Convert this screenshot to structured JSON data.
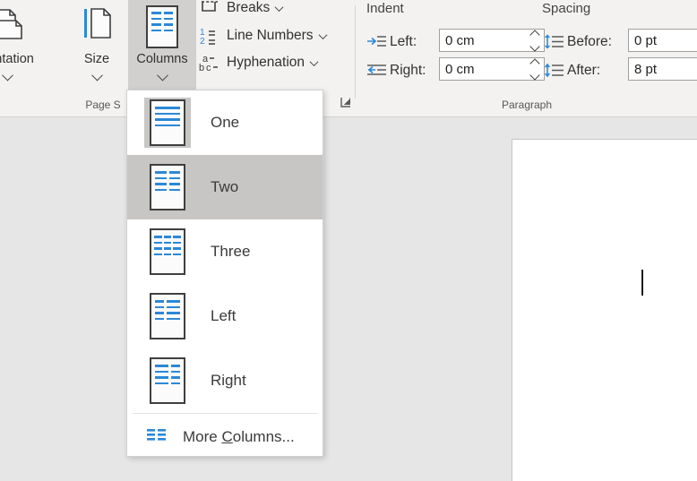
{
  "ribbon": {
    "groups": [
      {
        "label": "Page S",
        "full_label": "Page Setup"
      },
      {
        "label": "Paragraph",
        "full_label": "Paragraph"
      }
    ],
    "page_setup": {
      "buttons": [
        {
          "label": "rientation",
          "full_label": "Orientation",
          "icon": "orientation-icon",
          "has_dropdown": true
        },
        {
          "label": "Size",
          "icon": "page-size-icon",
          "has_dropdown": true
        },
        {
          "label": "Columns",
          "icon": "columns-icon",
          "has_dropdown": true,
          "active": true
        }
      ],
      "small_buttons": [
        {
          "label": "Breaks",
          "icon": "breaks-icon",
          "has_dropdown": true
        },
        {
          "label": "Line Numbers",
          "icon": "line-numbers-icon",
          "has_dropdown": true
        },
        {
          "label": "Hyphenation",
          "icon": "hyphenation-icon",
          "has_dropdown": true
        }
      ],
      "dialog_launcher": "page-setup-dialog-launcher"
    },
    "paragraph": {
      "indent_title": "Indent",
      "spacing_title": "Spacing",
      "fields": [
        {
          "label": "Left:",
          "value": "0 cm",
          "icon": "indent-left-icon"
        },
        {
          "label": "Right:",
          "value": "0 cm",
          "icon": "indent-right-icon"
        },
        {
          "label": "Before:",
          "value": "0 pt",
          "icon": "spacing-before-icon"
        },
        {
          "label": "After:",
          "value": "8 pt",
          "icon": "spacing-after-icon"
        }
      ]
    }
  },
  "columns_menu": {
    "items": [
      {
        "label": "One",
        "icon": "columns-one-icon",
        "selected": true,
        "hover": false
      },
      {
        "label": "Two",
        "icon": "columns-two-icon",
        "selected": false,
        "hover": true
      },
      {
        "label": "Three",
        "icon": "columns-three-icon",
        "selected": false,
        "hover": false
      },
      {
        "label": "Left",
        "icon": "columns-left-icon",
        "selected": false,
        "hover": false
      },
      {
        "label": "Right",
        "icon": "columns-right-icon",
        "selected": false,
        "hover": false
      }
    ],
    "more": {
      "label_prefix": "More ",
      "label_accel": "C",
      "label_suffix": "olumns...",
      "icon": "more-columns-icon"
    }
  },
  "document": {
    "caret_visible": true
  },
  "colors": {
    "accent_blue": "#2b88d8",
    "ribbon_bg": "#f3f2f1",
    "workspace_bg": "#e6e6e6",
    "hover_gray": "#c8c6c4",
    "text": "#323130"
  }
}
